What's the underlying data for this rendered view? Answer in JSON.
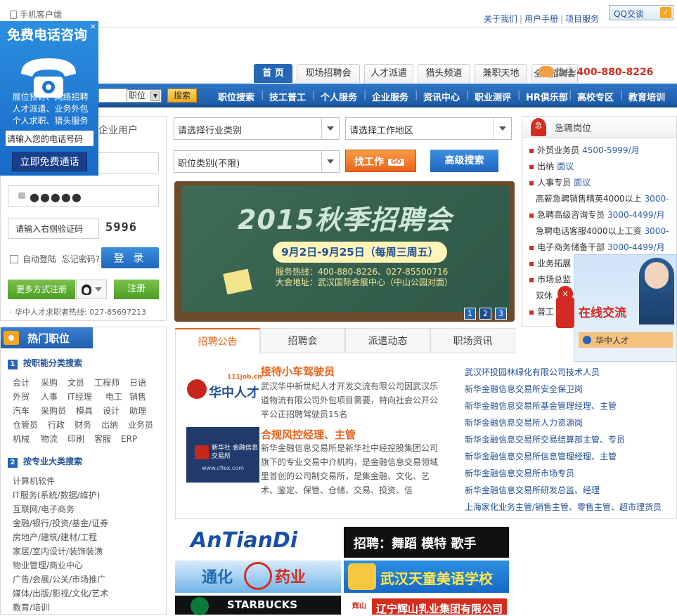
{
  "topbar": {
    "mobile_client": "手机客户端",
    "links": [
      "关于我们",
      "用户手册",
      "项目服务"
    ],
    "qq_chat": "QQ交谈"
  },
  "tabs": [
    "首 页",
    "现场招聘会",
    "人才派遣",
    "猎头频道",
    "兼职天地",
    "全国招聘会"
  ],
  "hotline": {
    "label": "热线:",
    "number": "400-880-8226"
  },
  "search": {
    "select_value": "职位",
    "button": "搜索"
  },
  "nav": [
    "职位搜索",
    "技工普工",
    "个人服务",
    "企业服务",
    "资讯中心",
    "职业测评",
    "HR俱乐部",
    "高校专区",
    "教育培训"
  ],
  "float_ad": {
    "title": "免费电话咨询",
    "close": "×",
    "desc": "展位预订、网络招聘 人才派遣、业务外包 个人求职、猎头服务",
    "phone_placeholder": "请输入您的电话号码",
    "call_button": "立即免费通话"
  },
  "login": {
    "enterprise_tab": "企业用户",
    "password_mask": "●●●●●",
    "captcha_placeholder": "请输入右侧验证码",
    "captcha_code": "5996",
    "auto_login": "自动登陆",
    "forgot": "忘记密码?",
    "login_button": "登 录",
    "more_register": "更多方式注册",
    "register_button": "注册",
    "seeker_hotline": "· 华中人才求职者热线: 027-85697213"
  },
  "hot_jobs": {
    "title": "热门职位",
    "section1": {
      "num": "1",
      "title": "按职能分类搜索",
      "rows": [
        [
          "会计",
          "采购",
          "文员",
          "工程师",
          "日语"
        ],
        [
          "外贸",
          "人事",
          "IT经理",
          "电工",
          "销售"
        ],
        [
          "汽车",
          "采购员",
          "模具",
          "设计",
          "助理"
        ],
        [
          "仓管员",
          "行政",
          "财务",
          "出纳",
          "业务员"
        ],
        [
          "机械",
          "物流",
          "印刷",
          "客服",
          "ERP"
        ]
      ]
    },
    "section2": {
      "num": "2",
      "title": "按专业大类搜索",
      "items": [
        "计算机软件",
        "IT服务(系统/数据/维护)",
        "互联网/电子商务",
        "金融/银行/投资/基金/证券",
        "房地产/建筑/建材/工程",
        "家居/室内设计/装饰装潢",
        "物业管理/商业中心",
        "广告/会展/公关/市场推广",
        "媒体/出版/影视/文化/艺术",
        "教育/培训"
      ]
    }
  },
  "job_search": {
    "industry": "请选择行业类别",
    "area": "请选择工作地区",
    "category": "职位类别(不限)",
    "find_button": "找工作",
    "go": "GO",
    "advanced": "高级搜索"
  },
  "banner": {
    "title": "2015秋季招聘会",
    "date": "9月2日-9月25日（每周三周五）",
    "line1": "服务热线：400-880-8226、027-85500716",
    "line2": "大会地址：武汉国际会展中心（中山公园对面）",
    "pages": [
      "1",
      "2",
      "3"
    ]
  },
  "urgent": {
    "title": "急聘岗位",
    "badge": "急",
    "items": [
      {
        "job": "外贸业务员",
        "salary": "4500-5999/月"
      },
      {
        "job": "出纳",
        "salary": "面议"
      },
      {
        "job": "人事专员",
        "salary": "面议"
      },
      {
        "job": "高薪急聘销售精英4000以上",
        "salary": "3000-"
      },
      {
        "job": "急聘高级咨询专员",
        "salary": "3000-4499/月"
      },
      {
        "job": "急聘电话客服4000以上工资",
        "salary": "3000-"
      },
      {
        "job": "电子商务储备干部",
        "salary": "3000-4499/月"
      },
      {
        "job": "业务拓展",
        "salary": ""
      },
      {
        "job": "市场总监",
        "salary": ""
      },
      {
        "job": "双休",
        "salary": ""
      },
      {
        "job": "普工",
        "salary": ""
      }
    ]
  },
  "chat": {
    "title": "在线交流",
    "name": "华中人才",
    "close": "×"
  },
  "news": {
    "tabs": [
      "招聘公告",
      "招聘会",
      "派遣动态",
      "职场资讯"
    ],
    "items": [
      {
        "logo": "华中人才",
        "logo_url": "111job.cn",
        "title": "接待小车驾驶员",
        "text": "武汉华中新世纪人才开发交流有限公司因武汉乐道物流有限公司外包项目需要，特向社会公开公平公正招聘驾驶员15名"
      },
      {
        "logo": "新华社 金融信息交易所",
        "logo_url": "www.cfiex.com",
        "title": "合规风控经理、主管",
        "text": "新华金融信息交易所是新华社中经控股集团公司旗下的专业交易中介机构，是金融信息交易领域里首创的公司制交易所，是集金融、文化、艺术、鉴定、保管、仓储、交易、投资、信"
      }
    ],
    "links": [
      "武汉环投园林绿化有限公司技术人员",
      "新华金融信息交易所安全保卫岗",
      "新华金融信息交易所基金管理经理、主管",
      "新华金融信息交易所人力资源岗",
      "新华金融信息交易所交易结算部主管、专员",
      "新华金融信息交易所信息管理经理、主管",
      "新华金融信息交易所市场专员",
      "新华金融信息交易所研发总监、经理",
      "上海家化业务主管/销售主管、零售主管、超市理货员"
    ]
  },
  "ads": {
    "a1": "AnTianDi",
    "a2": "招聘：舞蹈 模特 歌手",
    "a3": "通化",
    "a3b": "药业",
    "a4": "武汉天童美语学校",
    "a5": "STARBUCKS",
    "a6": "辽宁辉山乳业集团有限公司",
    "a6_logo": "辉山"
  },
  "colors": {
    "brand_blue": "#2566b5",
    "accent_orange": "#e8641a",
    "hotline_red": "#d32d1e"
  }
}
